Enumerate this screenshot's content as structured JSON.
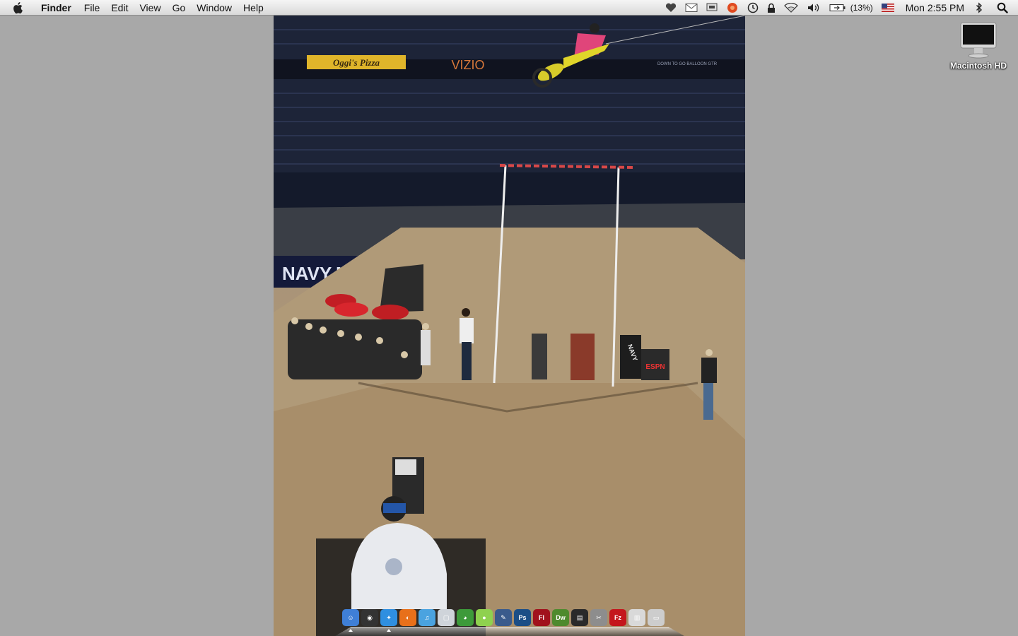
{
  "menubar": {
    "app_name": "Finder",
    "items": [
      "File",
      "Edit",
      "View",
      "Go",
      "Window",
      "Help"
    ],
    "battery_percent": "(13%)",
    "clock": "Mon 2:55 PM"
  },
  "desktop": {
    "icons": [
      {
        "label": "Macintosh HD"
      }
    ]
  },
  "wallpaper": {
    "banners": [
      "Oggi's Pizza",
      "VIZIO",
      "NAVY",
      "NAVY",
      "DOWN TO GO BALLOON GTR",
      "ESPN"
    ]
  },
  "dock": {
    "items": [
      {
        "name": "Finder",
        "glyph": "☺",
        "color": "#3f7fd6",
        "running": true
      },
      {
        "name": "Dashboard",
        "glyph": "◉",
        "color": "#333333",
        "running": false
      },
      {
        "name": "Safari",
        "glyph": "✦",
        "color": "#2f8fe0",
        "running": true
      },
      {
        "name": "Firefox",
        "glyph": "◐",
        "color": "#e8701a",
        "running": false
      },
      {
        "name": "iTunes",
        "glyph": "♫",
        "color": "#4aa3e0",
        "running": false
      },
      {
        "name": "Preview",
        "glyph": "▢",
        "color": "#cfd4da",
        "running": false
      },
      {
        "name": "Adium",
        "glyph": "◕",
        "color": "#3d9a3a",
        "running": false
      },
      {
        "name": "Tennis",
        "glyph": "●",
        "color": "#8fd14f",
        "running": false
      },
      {
        "name": "Xcode",
        "glyph": "✎",
        "color": "#3a5b8c",
        "running": false
      },
      {
        "name": "Photoshop",
        "glyph": "Ps",
        "color": "#1b4e86",
        "running": false
      },
      {
        "name": "Flash",
        "glyph": "Fl",
        "color": "#a1121c",
        "running": false
      },
      {
        "name": "Dreamweaver",
        "glyph": "Dw",
        "color": "#4e8a2e",
        "running": false
      },
      {
        "name": "Final Cut",
        "glyph": "▤",
        "color": "#2a2a2a",
        "running": false
      },
      {
        "name": "Script Editor",
        "glyph": "✂",
        "color": "#8d8d8d",
        "running": false
      },
      {
        "name": "FileZilla",
        "glyph": "Fz",
        "color": "#c4161c",
        "running": false
      },
      {
        "name": "Documents",
        "glyph": "▥",
        "color": "#d9d9d9",
        "running": false
      },
      {
        "name": "Trash",
        "glyph": "▭",
        "color": "#cdcdcd",
        "running": false
      }
    ]
  }
}
